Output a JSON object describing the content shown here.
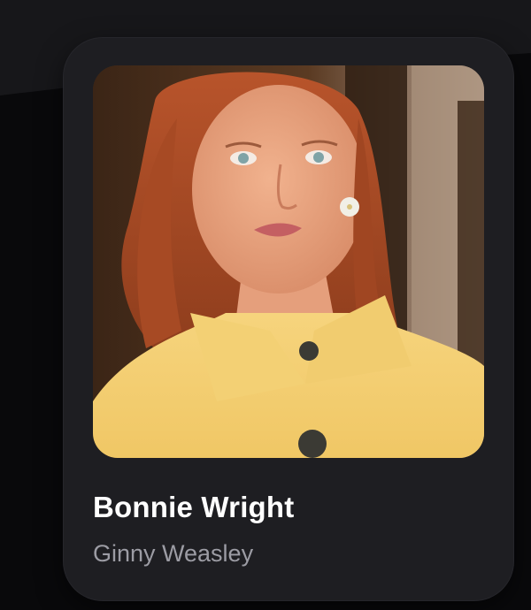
{
  "card": {
    "name": "Bonnie Wright",
    "role": "Ginny Weasley"
  },
  "photo": {
    "icon": "portrait-photo"
  },
  "colors": {
    "background": "#0a0a0c",
    "card": "#1e1e22",
    "name_text": "#ffffff",
    "role_text": "#9c9ca4"
  }
}
